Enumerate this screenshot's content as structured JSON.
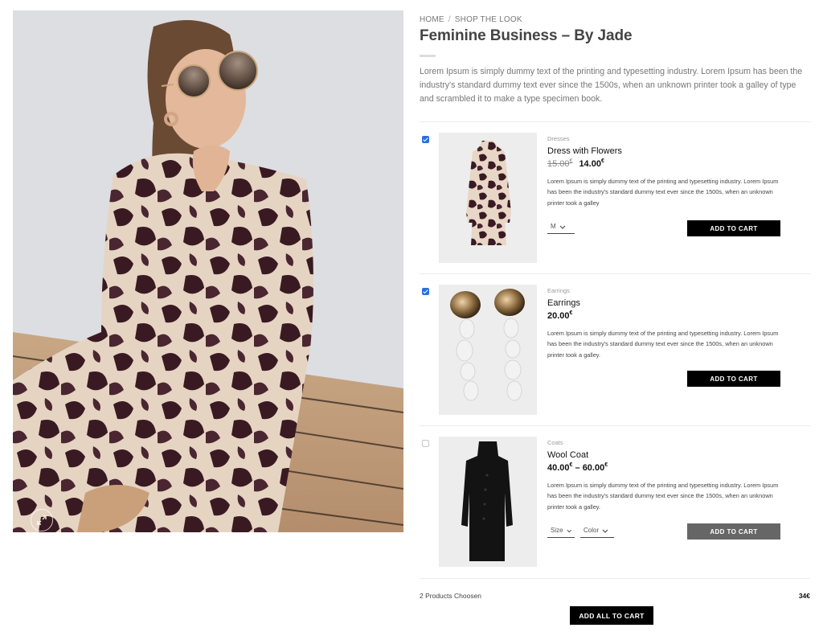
{
  "hero": {
    "image_alt": "Woman in round sunglasses wearing a dark floral print dress, seated on a wooden deck",
    "zoom_icon": "expand-icon"
  },
  "breadcrumb": {
    "items": [
      "HOME",
      "SHOP THE LOOK"
    ],
    "separator": "/"
  },
  "page": {
    "title": "Feminine Business – By Jade",
    "intro": "Lorem Ipsum is simply dummy text of the printing and typesetting industry. Lorem Ipsum has been the industry's standard dummy text ever since the 1500s, when an unknown printer took a galley of type and scrambled it to make a type specimen book."
  },
  "products": [
    {
      "checked": true,
      "category": "Dresses",
      "name": "Dress with Flowers",
      "old_price": "15.00",
      "price": "14.00",
      "currency": "€",
      "description": "Lorem Ipsum is simply dummy text of the printing and typesetting industry. Lorem Ipsum has been the industry's standard dummy text ever since the 1500s, when an unknown printer took a galley",
      "variants": [
        {
          "label": "M",
          "icon": "chevron-down-icon"
        }
      ],
      "button_label": "ADD TO CART",
      "button_enabled": true
    },
    {
      "checked": true,
      "category": "Earrings",
      "name": "Earrings",
      "price": "20.00",
      "currency": "€",
      "description": "Lorem Ipsum is simply dummy text of the printing and typesetting industry. Lorem Ipsum has been the industry's standard dummy text ever since the 1500s, when an unknown printer took a galley.",
      "variants": [],
      "button_label": "ADD TO CART",
      "button_enabled": true
    },
    {
      "checked": false,
      "category": "Coats",
      "name": "Wool Coat",
      "price_min": "40.00",
      "price_max": "60.00",
      "price_sep": "–",
      "currency": "€",
      "description": "Lorem Ipsum is simply dummy text of the printing and typesetting industry. Lorem Ipsum has been the industry's standard dummy text ever since the 1500s, when an unknown printer took a galley.",
      "variants": [
        {
          "label": "Size",
          "icon": "chevron-down-icon"
        },
        {
          "label": "Color",
          "icon": "chevron-down-icon"
        }
      ],
      "button_label": "ADD TO CART",
      "button_enabled": false
    }
  ],
  "summary": {
    "count_label": "2 Products Choosen",
    "total": "34€",
    "add_all_label": "ADD ALL TO CART"
  },
  "colors": {
    "checkbox_accent": "#2a6fe0",
    "button_primary": "#000000",
    "button_disabled": "#666666",
    "dress_print_dark": "#3a1a22",
    "dress_print_light": "#e8d6c6"
  }
}
